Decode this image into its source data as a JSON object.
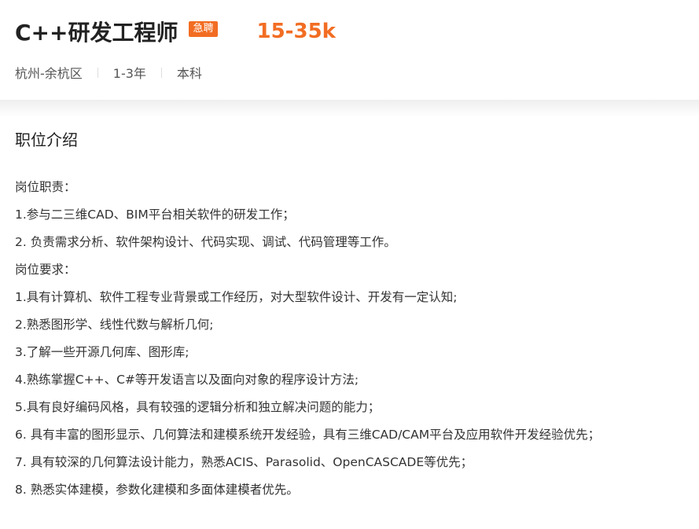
{
  "job": {
    "title": "C++研发工程师",
    "badge": "急聘",
    "salary": "15-35k",
    "location": "杭州-余杭区",
    "experience": "1-3年",
    "education": "本科"
  },
  "colors": {
    "accent": "#f26d23",
    "title_text": "#222222",
    "body_text": "#333333"
  },
  "section": {
    "title": "职位介绍",
    "lines": [
      "岗位职责：",
      "1.参与二三维CAD、BIM平台相关软件的研发工作；",
      "2. 负责需求分析、软件架构设计、代码实现、调试、代码管理等工作。",
      "岗位要求：",
      "1.具有计算机、软件工程专业背景或工作经历，对大型软件设计、开发有一定认知;",
      "2.熟悉图形学、线性代数与解析几何;",
      "3.了解一些开源几何库、图形库;",
      "4.熟练掌握C++、C#等开发语言以及面向对象的程序设计方法;",
      "5.具有良好编码风格，具有较强的逻辑分析和独立解决问题的能力；",
      "6. 具有丰富的图形显示、几何算法和建模系统开发经验，具有三维CAD/CAM平台及应用软件开发经验优先；",
      "7. 具有较深的几何算法设计能力，熟悉ACIS、Parasolid、OpenCASCADE等优先；",
      "8. 熟悉实体建模，参数化建模和多面体建模者优先。"
    ]
  }
}
